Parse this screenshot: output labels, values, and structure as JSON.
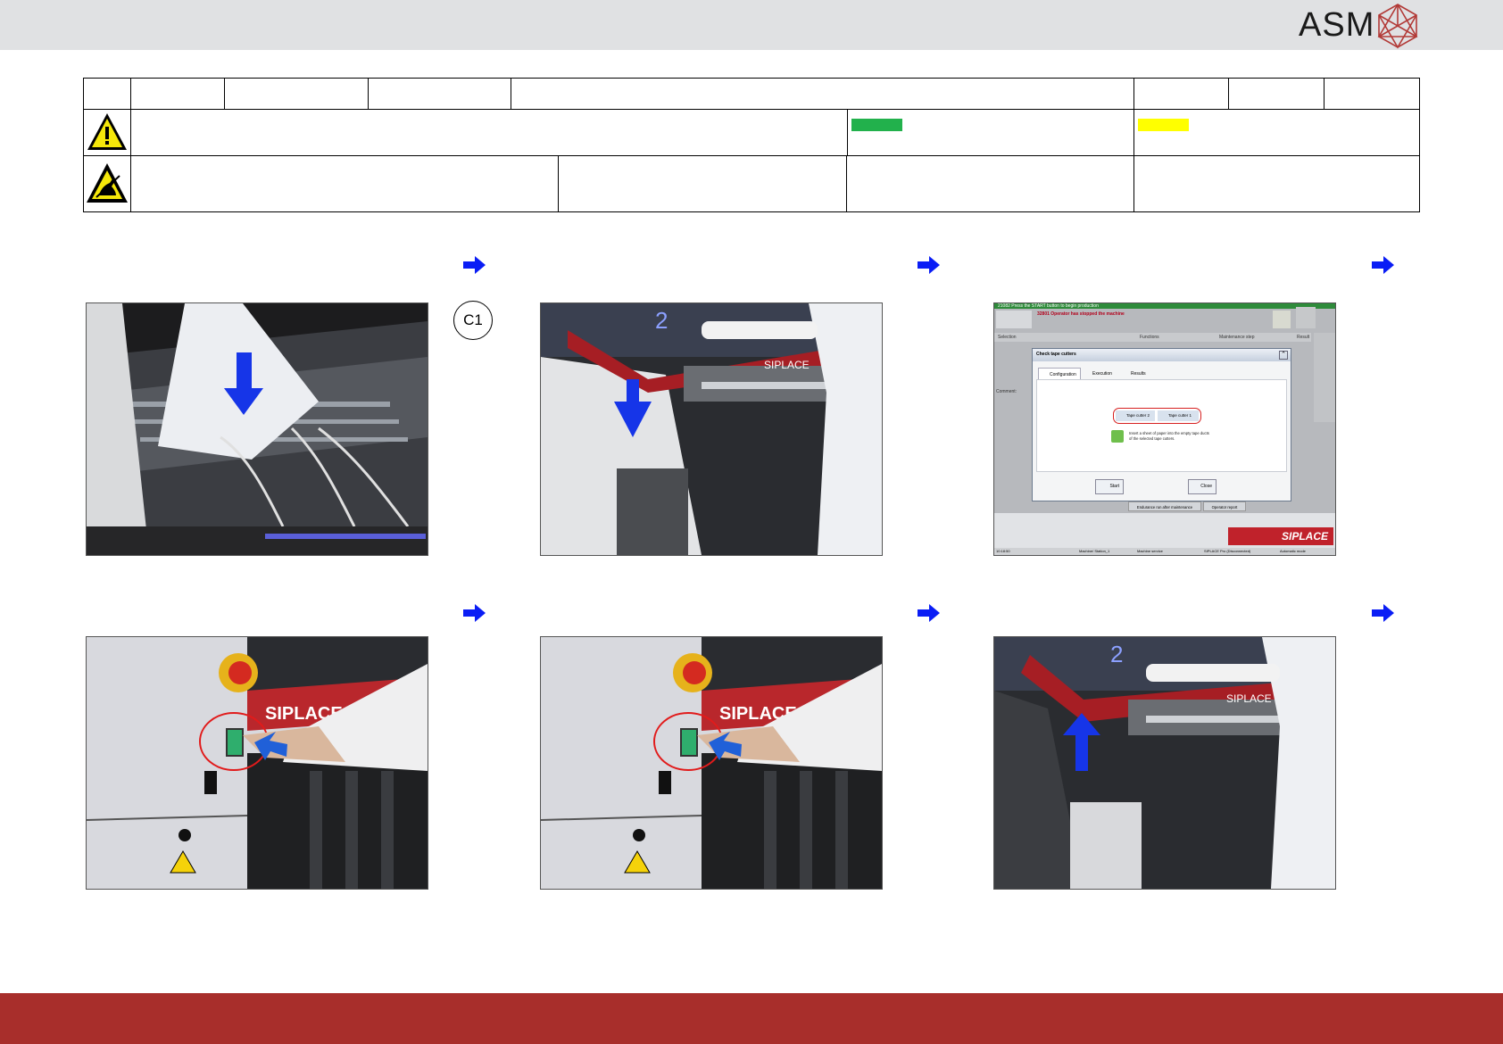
{
  "brand": {
    "name": "ASM",
    "accent": "#a82e2b",
    "logo_icon": "asm-crystal-logo"
  },
  "header_table": {
    "warning_icon": "warning-triangle-icon",
    "esd_icon": "esd-protection-icon",
    "green_status_color": "#22b14c",
    "yellow_status_color": "#ffff00"
  },
  "steps": {
    "step_arrow_icon": "right-arrow-icon",
    "callout_label": "C1",
    "photo1": {
      "alt": "paper-into-tape-cutter-photo"
    },
    "photo2": {
      "alt": "lower-cover-photo",
      "label": "SIPLACE",
      "number": "2"
    },
    "photo4": {
      "label": "SIPLACE"
    },
    "photo5": {
      "label": "SIPLACE"
    },
    "photo6": {
      "label": "SIPLACE",
      "number": "2"
    }
  },
  "screen": {
    "status_line": "21082 Press the START button to begin production",
    "alarm_line": "32801 Operator has stopped the machine",
    "columns": [
      "Selection",
      "Functions",
      "Maintenance step",
      "Result"
    ],
    "comment_label": "Comment:",
    "dialog": {
      "title": "Check tape cutters",
      "tabs": [
        "Configuration",
        "Execution",
        "Results"
      ],
      "checkboxes": [
        "Tape cutter 2",
        "Tape cutter 1"
      ],
      "hint": "Insert a sheet of paper into the empty tape ducts of the selected tape cutters.",
      "start_label": "Start",
      "close_label": "Close"
    },
    "lower_buttons": [
      "Endurance run after maintenance",
      "Operator report"
    ],
    "brand_label": "SIPLACE",
    "statusbar": [
      "10:18:50",
      "Machine/ Station_1",
      "Machine service",
      "SIPLACE Pro (Disconnected)",
      "Automatic mode"
    ]
  }
}
